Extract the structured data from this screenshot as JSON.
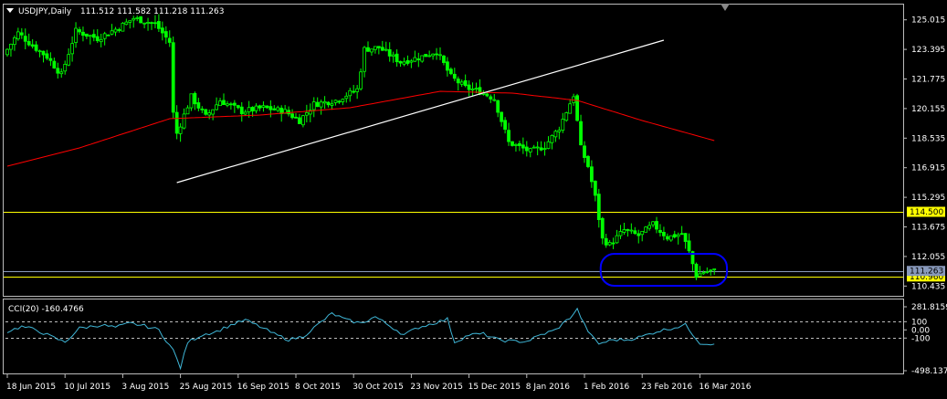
{
  "header": {
    "symbol": "USDJPY,Daily",
    "ohlc": "111.512 111.582 111.218 111.263"
  },
  "chart_data": {
    "type": "candlestick",
    "price_ticks": [
      "125.015",
      "123.395",
      "121.775",
      "120.155",
      "118.535",
      "116.915",
      "115.295",
      "113.675",
      "112.055",
      "110.435"
    ],
    "price_range": [
      110.0,
      125.6
    ],
    "date_labels": [
      "18 Jun 2015",
      "10 Jul 2015",
      "3 Aug 2015",
      "25 Aug 2015",
      "16 Sep 2015",
      "8 Oct 2015",
      "30 Oct 2015",
      "23 Nov 2015",
      "15 Dec 2015",
      "8 Jan 2016",
      "1 Feb 2016",
      "23 Feb 2016",
      "16 Mar 2016"
    ],
    "label_bars": [
      0,
      16,
      32,
      48,
      64,
      80,
      96,
      112,
      128,
      144,
      160,
      176,
      192
    ],
    "bar_count": 197,
    "price_anchors": [
      [
        0,
        123.1
      ],
      [
        4,
        124.3
      ],
      [
        8,
        123.6
      ],
      [
        12,
        123.0
      ],
      [
        16,
        122.0
      ],
      [
        20,
        124.4
      ],
      [
        26,
        124.0
      ],
      [
        32,
        124.6
      ],
      [
        36,
        125.1
      ],
      [
        42,
        124.8
      ],
      [
        46,
        123.8
      ],
      [
        47,
        119.9
      ],
      [
        48,
        118.8
      ],
      [
        52,
        120.8
      ],
      [
        56,
        119.7
      ],
      [
        60,
        120.6
      ],
      [
        66,
        120.0
      ],
      [
        72,
        120.2
      ],
      [
        78,
        120.0
      ],
      [
        82,
        119.5
      ],
      [
        86,
        120.4
      ],
      [
        92,
        120.6
      ],
      [
        98,
        121.2
      ],
      [
        100,
        123.4
      ],
      [
        104,
        123.5
      ],
      [
        110,
        122.7
      ],
      [
        116,
        123.0
      ],
      [
        120,
        123.3
      ],
      [
        124,
        121.9
      ],
      [
        128,
        121.3
      ],
      [
        132,
        121.1
      ],
      [
        136,
        120.7
      ],
      [
        140,
        118.3
      ],
      [
        146,
        117.8
      ],
      [
        150,
        118.1
      ],
      [
        154,
        119.1
      ],
      [
        158,
        120.9
      ],
      [
        160,
        118.0
      ],
      [
        162,
        117.0
      ],
      [
        164,
        115.3
      ],
      [
        166,
        113.0
      ],
      [
        168,
        112.7
      ],
      [
        172,
        113.5
      ],
      [
        176,
        113.2
      ],
      [
        180,
        113.8
      ],
      [
        184,
        113.1
      ],
      [
        188,
        113.3
      ],
      [
        190,
        112.3
      ],
      [
        192,
        111.0
      ],
      [
        194,
        111.2
      ],
      [
        196,
        111.26
      ]
    ],
    "ma": {
      "name": "",
      "anchors": [
        [
          0,
          117.0
        ],
        [
          20,
          118.0
        ],
        [
          45,
          119.6
        ],
        [
          70,
          119.8
        ],
        [
          95,
          120.2
        ],
        [
          120,
          121.1
        ],
        [
          140,
          121.0
        ],
        [
          158,
          120.6
        ],
        [
          176,
          119.5
        ],
        [
          196,
          118.4
        ]
      ]
    },
    "trendline": {
      "from": [
        47,
        116.1
      ],
      "to": [
        182,
        123.9
      ]
    },
    "horizontal_levels": [
      {
        "value": 114.5,
        "label": "114.500",
        "color": "#ffff00"
      },
      {
        "value": 110.96,
        "label": "110.960",
        "color": "#ffff00"
      },
      {
        "value": 111.263,
        "label": "111.263",
        "color": "#8899bb"
      }
    ],
    "highlight": {
      "bar_from": 165,
      "bar_to": 199,
      "price_top": 112.2,
      "price_bottom": 110.45,
      "color": "#0000ff"
    },
    "cci": {
      "label": "CCI(20) -160.4766",
      "ticks": [
        "281.8159",
        "100",
        "0.00",
        "-100",
        "-498.1371"
      ],
      "range": [
        -498.1371,
        281.8159
      ],
      "levels": [
        100,
        -100
      ],
      "anchors": [
        [
          0,
          -20
        ],
        [
          4,
          40
        ],
        [
          8,
          0
        ],
        [
          12,
          -80
        ],
        [
          16,
          -150
        ],
        [
          20,
          20
        ],
        [
          26,
          60
        ],
        [
          30,
          30
        ],
        [
          34,
          80
        ],
        [
          38,
          50
        ],
        [
          42,
          0
        ],
        [
          46,
          -250
        ],
        [
          48,
          -460
        ],
        [
          50,
          -150
        ],
        [
          54,
          -60
        ],
        [
          58,
          -20
        ],
        [
          62,
          60
        ],
        [
          66,
          120
        ],
        [
          70,
          40
        ],
        [
          74,
          -50
        ],
        [
          78,
          -120
        ],
        [
          82,
          -80
        ],
        [
          86,
          60
        ],
        [
          90,
          200
        ],
        [
          94,
          120
        ],
        [
          98,
          80
        ],
        [
          102,
          160
        ],
        [
          106,
          50
        ],
        [
          110,
          -60
        ],
        [
          114,
          30
        ],
        [
          118,
          80
        ],
        [
          122,
          130
        ],
        [
          124,
          -150
        ],
        [
          128,
          -60
        ],
        [
          132,
          -50
        ],
        [
          136,
          -120
        ],
        [
          140,
          -140
        ],
        [
          144,
          -140
        ],
        [
          148,
          -60
        ],
        [
          152,
          0
        ],
        [
          156,
          150
        ],
        [
          158,
          250
        ],
        [
          160,
          60
        ],
        [
          162,
          -80
        ],
        [
          164,
          -170
        ],
        [
          168,
          -120
        ],
        [
          172,
          -120
        ],
        [
          176,
          -80
        ],
        [
          180,
          -20
        ],
        [
          184,
          20
        ],
        [
          188,
          60
        ],
        [
          190,
          -50
        ],
        [
          192,
          -160
        ],
        [
          194,
          -170
        ],
        [
          196,
          -160
        ]
      ]
    }
  }
}
